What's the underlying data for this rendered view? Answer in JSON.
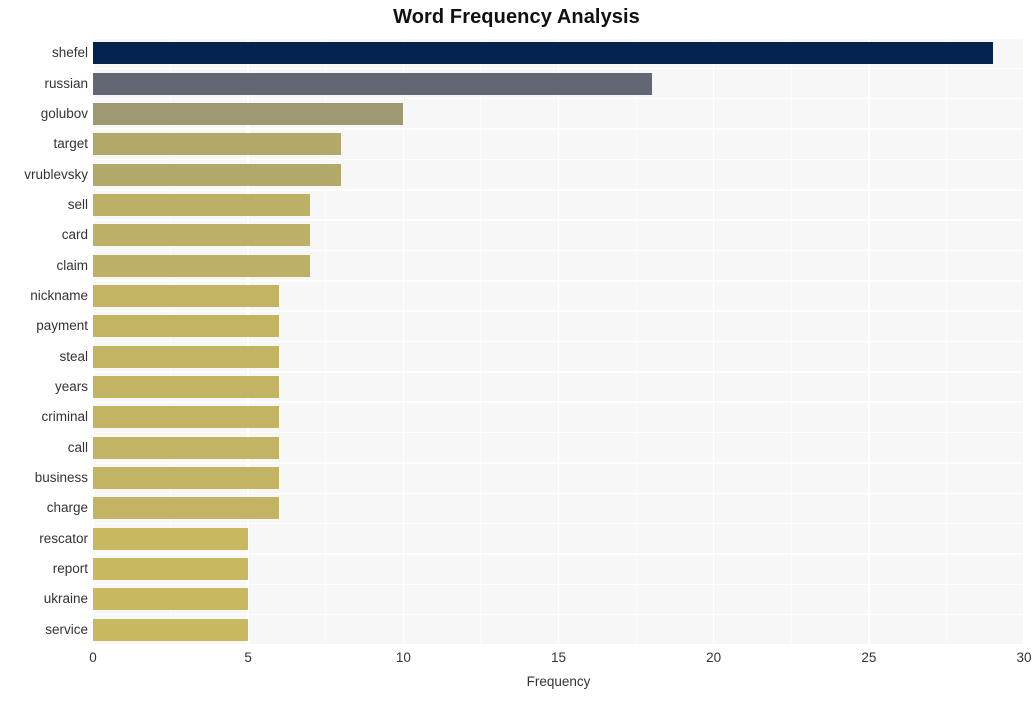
{
  "chart_data": {
    "type": "bar",
    "orientation": "horizontal",
    "title": "Word Frequency Analysis",
    "xlabel": "Frequency",
    "ylabel": "",
    "xlim": [
      0,
      30
    ],
    "xticks": [
      0,
      5,
      10,
      15,
      20,
      25,
      30
    ],
    "xtick_labels": [
      "0",
      "5",
      "10",
      "15",
      "20",
      "25",
      "30"
    ],
    "grid": true,
    "legend": false,
    "categories": [
      "shefel",
      "russian",
      "golubov",
      "target",
      "vrublevsky",
      "sell",
      "card",
      "claim",
      "nickname",
      "payment",
      "steal",
      "years",
      "criminal",
      "call",
      "business",
      "charge",
      "rescator",
      "report",
      "ukraine",
      "service"
    ],
    "values": [
      29,
      18,
      10,
      8,
      8,
      7,
      7,
      7,
      6,
      6,
      6,
      6,
      6,
      6,
      6,
      6,
      5,
      5,
      5,
      5
    ],
    "bar_colors": [
      "#04244f",
      "#636674",
      "#9e9873",
      "#b2a869",
      "#b2a869",
      "#bcaf66",
      "#bcaf66",
      "#bcaf66",
      "#c2b463",
      "#c2b463",
      "#c2b463",
      "#c2b463",
      "#c2b463",
      "#c2b463",
      "#c2b463",
      "#c2b463",
      "#c8b860",
      "#c8b860",
      "#c8b860",
      "#c8b860"
    ],
    "plot_background": "#f7f7f7",
    "grid_color": "#ffffff",
    "figure_background": "#ffffff"
  }
}
